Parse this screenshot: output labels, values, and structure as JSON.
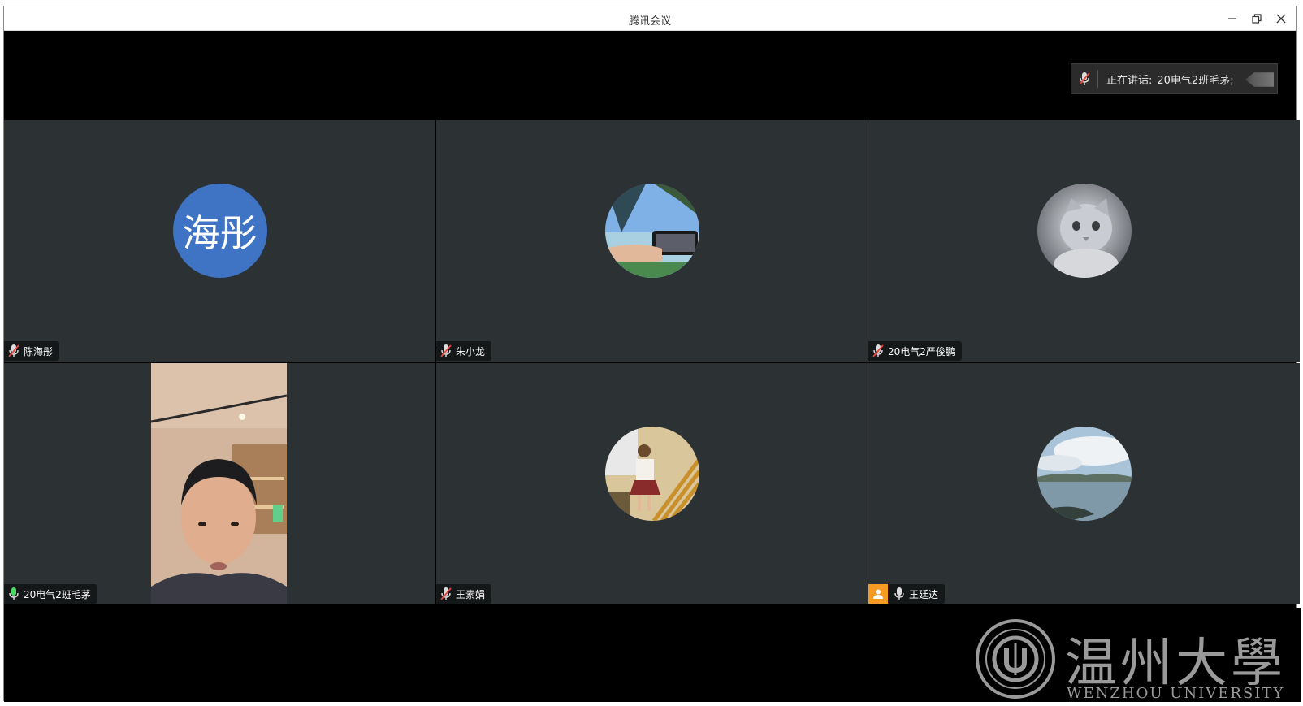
{
  "window": {
    "title": "腾讯会议"
  },
  "speaking": {
    "label": "正在讲话:",
    "speaker": "20电气2班毛茅;"
  },
  "tiles": [
    {
      "name": "陈海彤",
      "avatar_text": "海彤",
      "mic": "muted"
    },
    {
      "name": "朱小龙",
      "mic": "muted"
    },
    {
      "name": "20电气2严俊鹏",
      "mic": "muted"
    },
    {
      "name": "20电气2班毛茅",
      "mic": "active"
    },
    {
      "name": "王素娟",
      "mic": "muted"
    },
    {
      "name": "王廷达",
      "mic": "on"
    }
  ],
  "logo": {
    "cn": "温州大學",
    "en": "WENZHOU UNIVERSITY"
  },
  "colors": {
    "tile_bg": "#2c3133",
    "avatar_blue": "#3f73c4",
    "mic_active": "#4cd964",
    "mic_muted": "#e8453c",
    "badge_orange": "#f59a23"
  }
}
